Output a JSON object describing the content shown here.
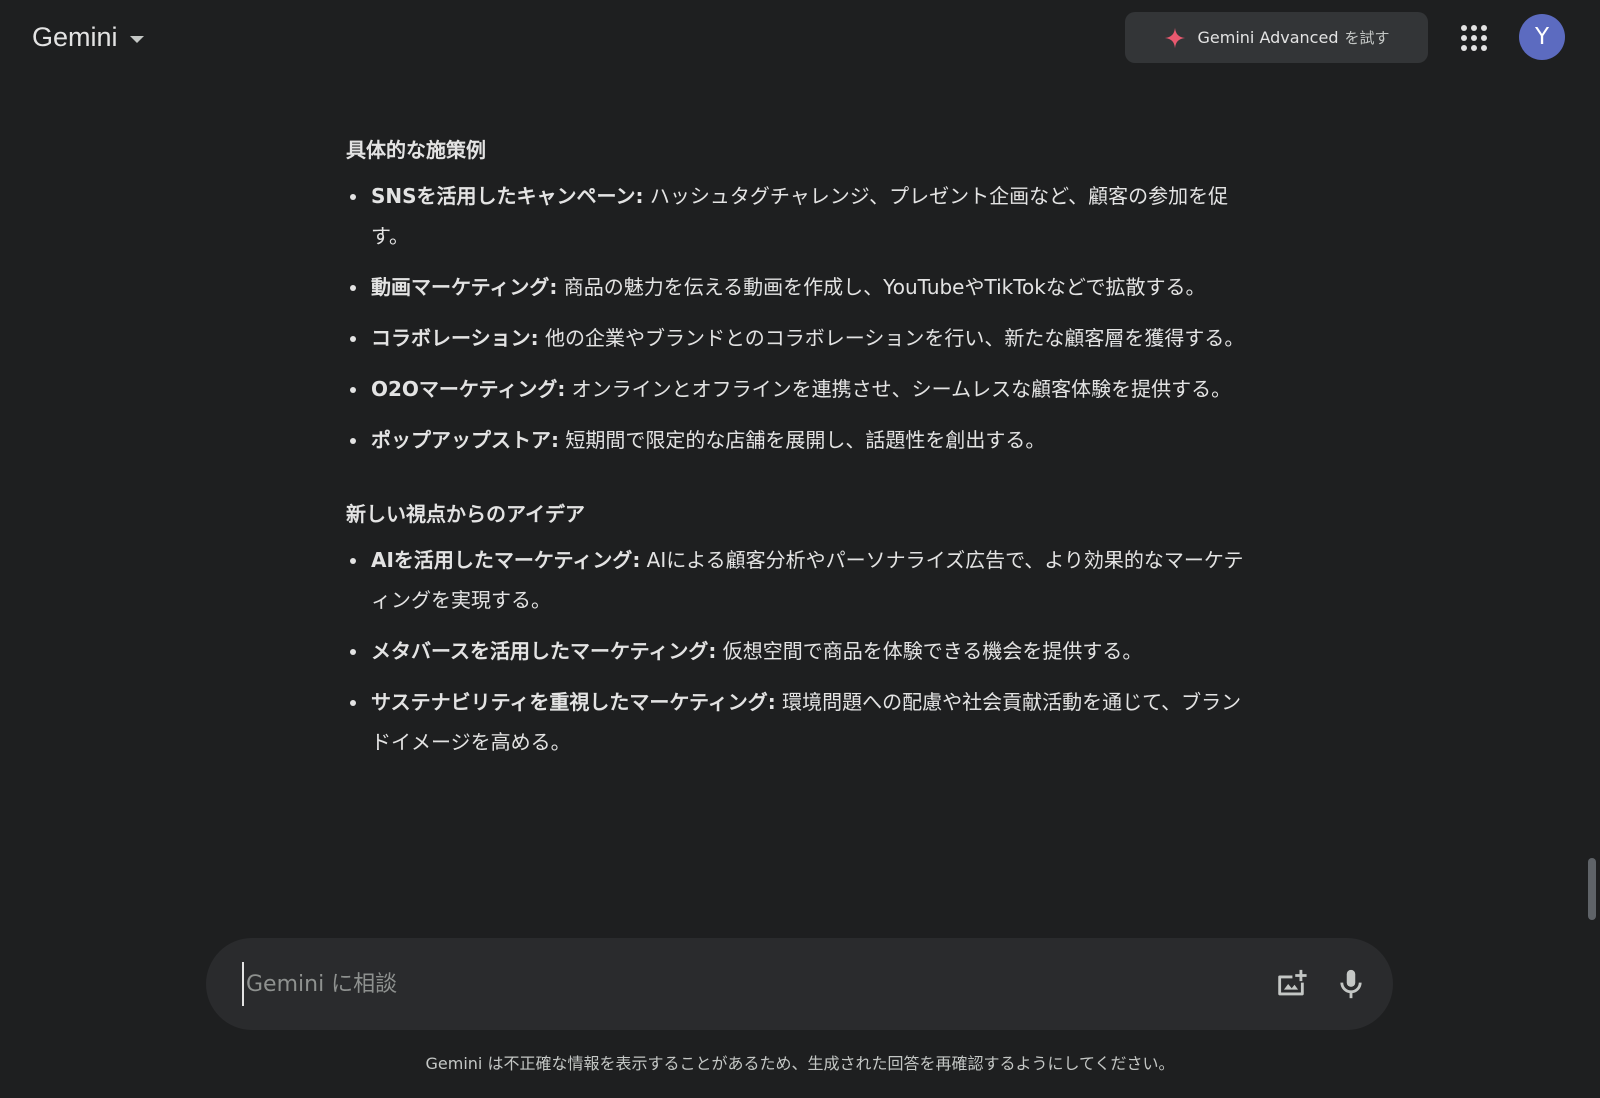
{
  "header": {
    "brand": "Gemini",
    "advanced_label": "Gemini Advanced",
    "advanced_suffix": "を試す",
    "avatar_letter": "Y"
  },
  "sections": [
    {
      "title": "具体的な施策例",
      "items": [
        {
          "term": "SNSを活用したキャンペーン:",
          "text": " ハッシュタグチャレンジ、プレゼント企画など、顧客の参加を促す。"
        },
        {
          "term": "動画マーケティング:",
          "text": " 商品の魅力を伝える動画を作成し、YouTubeやTikTokなどで拡散する。"
        },
        {
          "term": "コラボレーション:",
          "text": " 他の企業やブランドとのコラボレーションを行い、新たな顧客層を獲得する。"
        },
        {
          "term": "O2Oマーケティング:",
          "text": " オンラインとオフラインを連携させ、シームレスな顧客体験を提供する。"
        },
        {
          "term": "ポップアップストア:",
          "text": " 短期間で限定的な店舗を展開し、話題性を創出する。"
        }
      ]
    },
    {
      "title": "新しい視点からのアイデア",
      "items": [
        {
          "term": "AIを活用したマーケティング:",
          "text": " AIによる顧客分析やパーソナライズ広告で、より効果的なマーケティングを実現する。"
        },
        {
          "term": "メタバースを活用したマーケティング:",
          "text": " 仮想空間で商品を体験できる機会を提供する。"
        },
        {
          "term": "サステナビリティを重視したマーケティング:",
          "text": " 環境問題への配慮や社会貢献活動を通じて、ブランドイメージを高める。"
        }
      ]
    }
  ],
  "input": {
    "placeholder": "Gemini に相談",
    "value": ""
  },
  "disclaimer": "Gemini は不正確な情報を表示することがあるため、生成された回答を再確認するようにしてください。",
  "colors": {
    "background": "#1e1f20",
    "input_background": "#2a2b2d",
    "button_background": "#333537",
    "avatar": "#5c6bc0",
    "sparkle": "#e8596f"
  },
  "icons": [
    "sparkle-icon",
    "apps-grid-icon",
    "add-image-icon",
    "microphone-icon",
    "chevron-down-icon"
  ]
}
